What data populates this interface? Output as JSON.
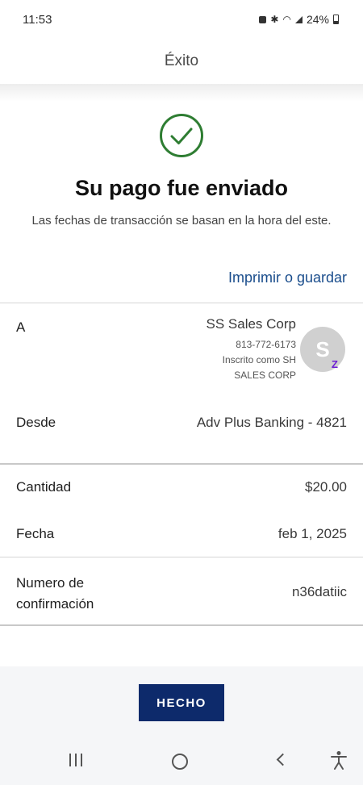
{
  "status_bar": {
    "time": "11:53",
    "battery": "24%"
  },
  "header": {
    "title": "Éxito"
  },
  "success": {
    "title": "Su pago fue enviado",
    "subtitle": "Las fechas de transacción se basan en la hora del este.",
    "print_link": "Imprimir o guardar"
  },
  "details": {
    "to": {
      "label": "A",
      "name": "SS Sales Corp",
      "phone": "813-772-6173",
      "enrolled_as": "Inscrito como SH",
      "enrolled_name": "SALES CORP",
      "avatar_initial": "S",
      "badge": "Z"
    },
    "from": {
      "label": "Desde",
      "value": "Adv Plus Banking - 4821"
    },
    "amount": {
      "label": "Cantidad",
      "value": "$20.00"
    },
    "date": {
      "label": "Fecha",
      "value": "feb 1, 2025"
    },
    "confirmation": {
      "label": "Numero de confirmación",
      "value": "n36datiic"
    }
  },
  "footer": {
    "done_label": "HECHO"
  },
  "colors": {
    "accent": "#0d2a6b",
    "link": "#1a4d8c",
    "success": "#2e7d32",
    "zelle": "#6d1ed4"
  },
  "icons": {
    "success": "check-circle-icon",
    "nav": [
      "recent-apps-icon",
      "home-icon",
      "back-icon",
      "accessibility-icon"
    ]
  }
}
